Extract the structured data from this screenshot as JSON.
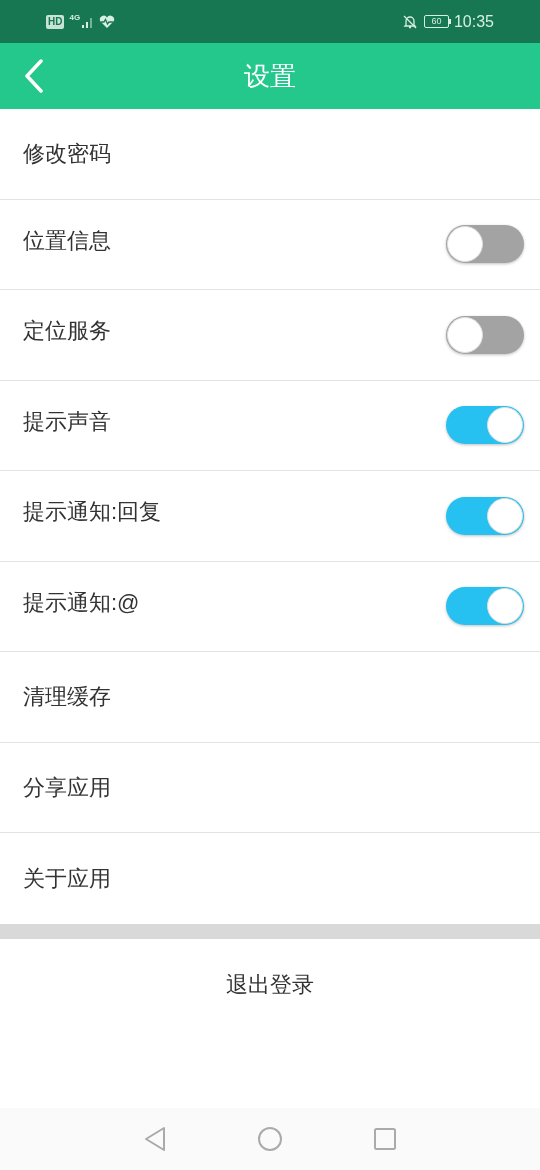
{
  "status_bar": {
    "hd": "HD",
    "network": "4G",
    "battery": "60",
    "time": "10:35"
  },
  "header": {
    "title": "设置"
  },
  "settings": [
    {
      "kind": "link",
      "label": "修改密码"
    },
    {
      "kind": "toggle",
      "label": "位置信息",
      "on": false
    },
    {
      "kind": "toggle",
      "label": "定位服务",
      "on": false
    },
    {
      "kind": "toggle",
      "label": "提示声音",
      "on": true
    },
    {
      "kind": "toggle",
      "label": "提示通知:回复",
      "on": true
    },
    {
      "kind": "toggle",
      "label": "提示通知:@",
      "on": true
    },
    {
      "kind": "link",
      "label": "清理缓存"
    },
    {
      "kind": "link",
      "label": "分享应用"
    },
    {
      "kind": "link",
      "label": "关于应用"
    }
  ],
  "logout": {
    "label": "退出登录"
  }
}
